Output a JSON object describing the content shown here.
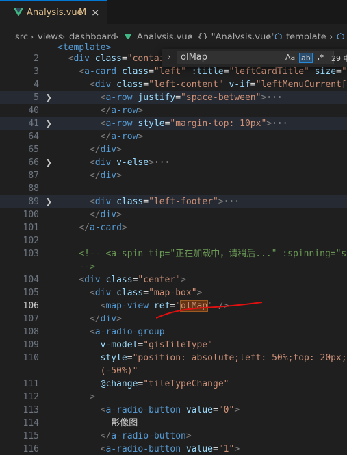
{
  "tab": {
    "name": "Analysis.vue",
    "modified": "M",
    "close": "×"
  },
  "breadcrumb": [
    "src",
    "views",
    "dashboard",
    "Analysis.vue",
    "{} \"Analysis.vue\"",
    "template"
  ],
  "find": {
    "value": "olMap",
    "match_case": "Aa",
    "whole_word": "ab",
    "regex": ".*",
    "result": "29 中"
  },
  "lines": [
    {
      "n": "2",
      "fold": "",
      "html": "  <span class=\"punct\">&lt;</span><span class=\"tag\">div</span> <span class=\"attr\">class</span>=<span class=\"str\">\"contai</span>"
    },
    {
      "n": "3",
      "fold": "",
      "html": "    <span class=\"punct\">&lt;</span><span class=\"tag\">a-card</span> <span class=\"attr\">class</span>=<span class=\"str\">\"left\"</span> <span class=\"attr\">:title</span>=<span class=\"str\">\"leftCardTitle\"</span> <span class=\"attr\">size</span>=<span class=\"str\">\"s</span>"
    },
    {
      "n": "4",
      "fold": "",
      "html": "      <span class=\"punct\">&lt;</span><span class=\"tag\">div</span> <span class=\"attr\">class</span>=<span class=\"str\">\"left-content\"</span> <span class=\"attr\">v-if</span>=<span class=\"str\">\"leftMenuCurrent[0</span>"
    },
    {
      "n": "5",
      "fold": ">",
      "hl": true,
      "html": "        <span class=\"punct\">&lt;</span><span class=\"tag\">a-row</span> <span class=\"attr\">justify</span>=<span class=\"str\">\"space-between\"</span><span class=\"punct\">&gt;</span><span class=\"fold-mark\">···</span>"
    },
    {
      "n": "40",
      "fold": "",
      "html": "        <span class=\"punct\">&lt;/</span><span class=\"tag\">a-row</span><span class=\"punct\">&gt;</span>"
    },
    {
      "n": "41",
      "fold": ">",
      "hl": true,
      "html": "        <span class=\"punct\">&lt;</span><span class=\"tag\">a-row</span> <span class=\"attr\">style</span>=<span class=\"str\">\"margin-top: 10px\"</span><span class=\"punct\">&gt;</span><span class=\"fold-mark\">···</span>"
    },
    {
      "n": "64",
      "fold": "",
      "html": "        <span class=\"punct\">&lt;/</span><span class=\"tag\">a-row</span><span class=\"punct\">&gt;</span>"
    },
    {
      "n": "65",
      "fold": "",
      "html": "      <span class=\"punct\">&lt;/</span><span class=\"tag\">div</span><span class=\"punct\">&gt;</span>"
    },
    {
      "n": "66",
      "fold": ">",
      "html": "      <span class=\"punct\">&lt;</span><span class=\"tag\">div</span> <span class=\"attr\">v-else</span><span class=\"punct\">&gt;</span><span class=\"fold-mark\">···</span>"
    },
    {
      "n": "87",
      "fold": "",
      "html": "      <span class=\"punct\">&lt;/</span><span class=\"tag\">div</span><span class=\"punct\">&gt;</span>"
    },
    {
      "n": "88",
      "fold": "",
      "html": ""
    },
    {
      "n": "89",
      "fold": ">",
      "hl": true,
      "html": "      <span class=\"punct\">&lt;</span><span class=\"tag\">div</span> <span class=\"attr\">class</span>=<span class=\"str\">\"left-footer\"</span><span class=\"punct\">&gt;</span><span class=\"fold-mark\">···</span>"
    },
    {
      "n": "100",
      "fold": "",
      "html": "      <span class=\"punct\">&lt;/</span><span class=\"tag\">div</span><span class=\"punct\">&gt;</span>"
    },
    {
      "n": "101",
      "fold": "",
      "html": "    <span class=\"punct\">&lt;/</span><span class=\"tag\">a-card</span><span class=\"punct\">&gt;</span>"
    },
    {
      "n": "102",
      "fold": "",
      "html": ""
    },
    {
      "n": "103",
      "fold": "",
      "html": "    <span class=\"cmt\">&lt;!-- &lt;a-spin tip=\"正在加载中，请稍后...\" :spinning=\"s</span>"
    },
    {
      "n": "",
      "fold": "",
      "html": "    <span class=\"cmt\">--&gt;</span>"
    },
    {
      "n": "104",
      "fold": "",
      "html": "    <span class=\"punct\">&lt;</span><span class=\"tag\">div</span> <span class=\"attr\">class</span>=<span class=\"str\">\"center\"</span><span class=\"punct\">&gt;</span>"
    },
    {
      "n": "105",
      "fold": "",
      "html": "      <span class=\"punct\">&lt;</span><span class=\"tag\">div</span> <span class=\"attr\">class</span>=<span class=\"str\">\"map-box\"</span><span class=\"punct\">&gt;</span>"
    },
    {
      "n": "106",
      "fold": "",
      "cur": true,
      "html": "        <span class=\"punct\">&lt;</span><span class=\"tag\">map-view</span> <span class=\"attr\">ref</span>=<span class=\"str\">\"<span class=\"find-hl\">olMap</span>\"</span> <span class=\"punct\">/&gt;</span>"
    },
    {
      "n": "107",
      "fold": "",
      "html": "      <span class=\"punct\">&lt;/</span><span class=\"tag\">div</span><span class=\"punct\">&gt;</span>"
    },
    {
      "n": "108",
      "fold": "",
      "html": "      <span class=\"punct\">&lt;</span><span class=\"tag\">a-radio-group</span>"
    },
    {
      "n": "109",
      "fold": "",
      "html": "        <span class=\"attr\">v-model</span>=<span class=\"str\">\"gisTileType\"</span>"
    },
    {
      "n": "110",
      "fold": "",
      "html": "        <span class=\"attr\">style</span>=<span class=\"str\">\"position: absolute;left: 50%;top: 20px;t</span>"
    },
    {
      "n": "",
      "fold": "",
      "html": "        <span class=\"str\">(-50%)\"</span>"
    },
    {
      "n": "111",
      "fold": "",
      "html": "        <span class=\"attr\">@change</span>=<span class=\"str\">\"tileTypeChange\"</span>"
    },
    {
      "n": "112",
      "fold": "",
      "html": "      <span class=\"punct\">&gt;</span>"
    },
    {
      "n": "113",
      "fold": "",
      "html": "        <span class=\"punct\">&lt;</span><span class=\"tag\">a-radio-button</span> <span class=\"attr\">value</span>=<span class=\"str\">\"0\"</span><span class=\"punct\">&gt;</span>"
    },
    {
      "n": "114",
      "fold": "",
      "html": "          影像图"
    },
    {
      "n": "115",
      "fold": "",
      "html": "        <span class=\"punct\">&lt;/</span><span class=\"tag\">a-radio-button</span><span class=\"punct\">&gt;</span>"
    },
    {
      "n": "116",
      "fold": "",
      "html": "        <span class=\"punct\">&lt;</span><span class=\"tag\">a-radio-button</span> <span class=\"attr\">value</span>=<span class=\"str\">\"1\"</span><span class=\"punct\">&gt;</span>"
    }
  ]
}
